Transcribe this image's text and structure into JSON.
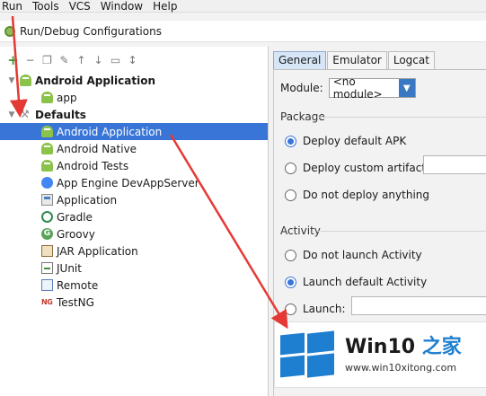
{
  "menu": [
    "Run",
    "Tools",
    "VCS",
    "Window",
    "Help"
  ],
  "dialog": {
    "title": "Run/Debug Configurations"
  },
  "tree": {
    "group_android": "Android Application",
    "app": "app",
    "group_defaults": "Defaults",
    "items": [
      {
        "label": "Android Application",
        "icon": "android-icon",
        "selected": true
      },
      {
        "label": "Android Native",
        "icon": "android-icon"
      },
      {
        "label": "Android Tests",
        "icon": "android-icon"
      },
      {
        "label": "App Engine DevAppServer",
        "icon": "app-engine-icon"
      },
      {
        "label": "Application",
        "icon": "application-icon"
      },
      {
        "label": "Gradle",
        "icon": "gradle-icon"
      },
      {
        "label": "Groovy",
        "icon": "groovy-icon"
      },
      {
        "label": "JAR Application",
        "icon": "jar-icon"
      },
      {
        "label": "JUnit",
        "icon": "junit-icon"
      },
      {
        "label": "Remote",
        "icon": "remote-icon"
      },
      {
        "label": "TestNG",
        "icon": "testng-icon"
      }
    ]
  },
  "tabs": [
    "General",
    "Emulator",
    "Logcat"
  ],
  "general": {
    "module_label": "Module:",
    "module_value": "<no module>",
    "package_section": "Package",
    "package_options": [
      "Deploy default APK",
      "Deploy custom artifact:",
      "Do not deploy anything"
    ],
    "activity_section": "Activity",
    "activity_options": [
      "Do not launch Activity",
      "Launch default Activity",
      "Launch:"
    ]
  },
  "watermark": {
    "title_main": "Win10",
    "title_accent": "之家",
    "url": "www.win10xitong.com"
  },
  "colors": {
    "selection": "#3875d7",
    "annotation_arrow": "#e53935",
    "android": "#8bc34a",
    "brand_blue": "#1e7fd0"
  }
}
